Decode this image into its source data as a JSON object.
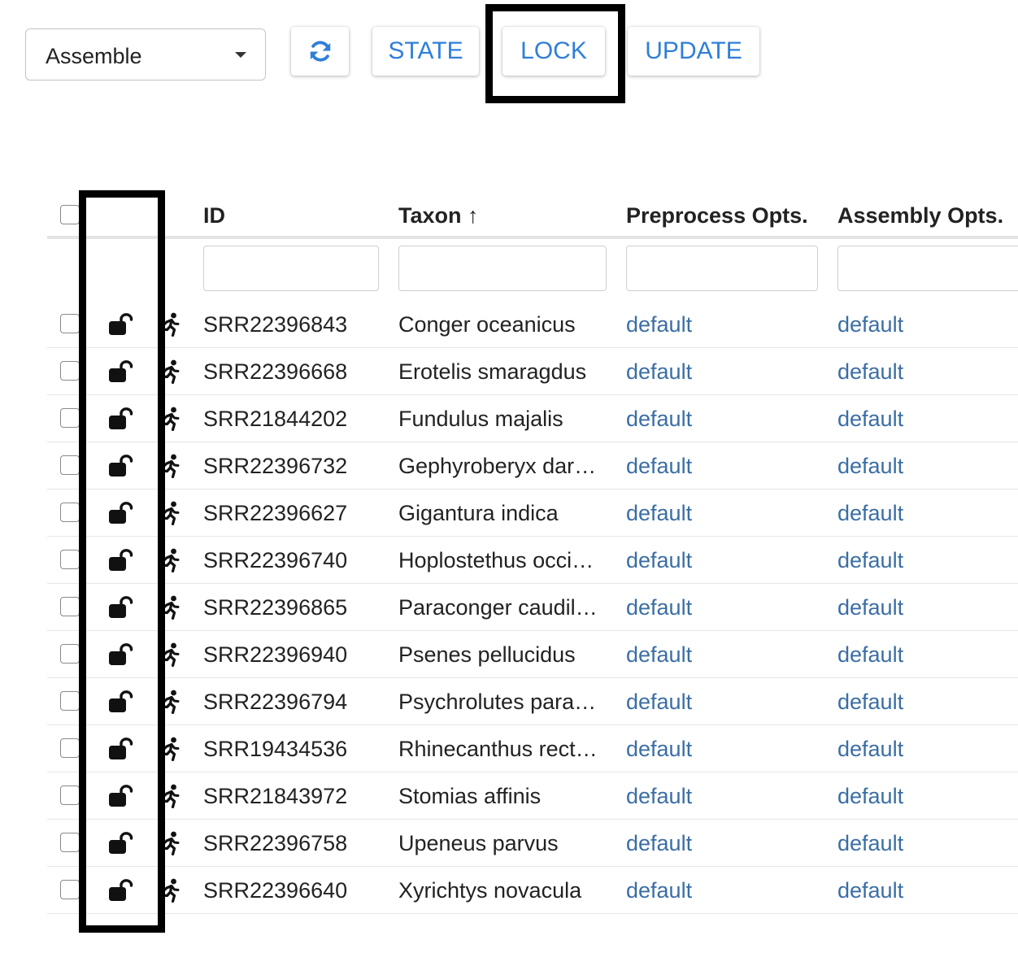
{
  "toolbar": {
    "mode_select": {
      "value": "Assemble"
    },
    "refresh_icon": "refresh-icon",
    "state_label": "STATE",
    "lock_label": "LOCK",
    "update_label": "UPDATE",
    "accent_color": "#2f7fd8"
  },
  "table": {
    "headers": {
      "id": "ID",
      "taxon": "Taxon ↑",
      "preprocess": "Preprocess Opts.",
      "assembly": "Assembly Opts."
    },
    "rows": [
      {
        "id": "SRR22396843",
        "taxon": "Conger oceanicus",
        "preprocess": "default",
        "assembly": "default",
        "lock": "unlocked",
        "status_icon": "running-icon"
      },
      {
        "id": "SRR22396668",
        "taxon": "Erotelis smaragdus",
        "preprocess": "default",
        "assembly": "default",
        "lock": "unlocked",
        "status_icon": "running-icon"
      },
      {
        "id": "SRR21844202",
        "taxon": "Fundulus majalis",
        "preprocess": "default",
        "assembly": "default",
        "lock": "unlocked",
        "status_icon": "running-icon"
      },
      {
        "id": "SRR22396732",
        "taxon": "Gephyroberyx dar…",
        "preprocess": "default",
        "assembly": "default",
        "lock": "unlocked",
        "status_icon": "running-icon"
      },
      {
        "id": "SRR22396627",
        "taxon": "Gigantura indica",
        "preprocess": "default",
        "assembly": "default",
        "lock": "unlocked",
        "status_icon": "running-icon"
      },
      {
        "id": "SRR22396740",
        "taxon": "Hoplostethus occi…",
        "preprocess": "default",
        "assembly": "default",
        "lock": "unlocked",
        "status_icon": "running-icon"
      },
      {
        "id": "SRR22396865",
        "taxon": "Paraconger caudil…",
        "preprocess": "default",
        "assembly": "default",
        "lock": "unlocked",
        "status_icon": "running-icon"
      },
      {
        "id": "SRR22396940",
        "taxon": "Psenes pellucidus",
        "preprocess": "default",
        "assembly": "default",
        "lock": "unlocked",
        "status_icon": "running-icon"
      },
      {
        "id": "SRR22396794",
        "taxon": "Psychrolutes para…",
        "preprocess": "default",
        "assembly": "default",
        "lock": "unlocked",
        "status_icon": "running-icon"
      },
      {
        "id": "SRR19434536",
        "taxon": "Rhinecanthus rect…",
        "preprocess": "default",
        "assembly": "default",
        "lock": "unlocked",
        "status_icon": "running-icon"
      },
      {
        "id": "SRR21843972",
        "taxon": "Stomias affinis",
        "preprocess": "default",
        "assembly": "default",
        "lock": "unlocked",
        "status_icon": "running-icon"
      },
      {
        "id": "SRR22396758",
        "taxon": "Upeneus parvus",
        "preprocess": "default",
        "assembly": "default",
        "lock": "unlocked",
        "status_icon": "running-icon"
      },
      {
        "id": "SRR22396640",
        "taxon": "Xyrichtys novacula",
        "preprocess": "default",
        "assembly": "default",
        "lock": "unlocked",
        "status_icon": "running-icon"
      }
    ],
    "link_color": "#3a6ea5"
  }
}
